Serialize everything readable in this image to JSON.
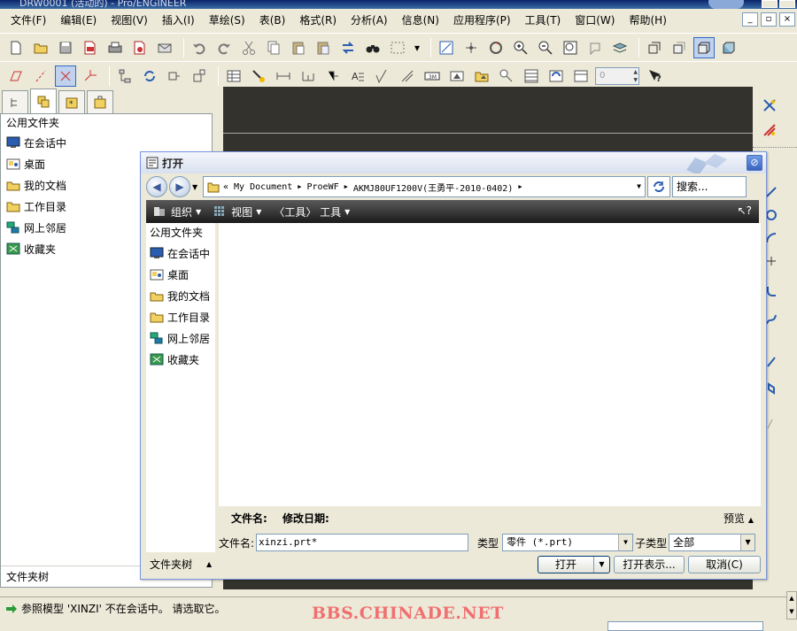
{
  "window": {
    "title": "DRW0001 (活动的) - Pro/ENGINEER"
  },
  "menu": [
    "文件(F)",
    "编辑(E)",
    "视图(V)",
    "插入(I)",
    "草绘(S)",
    "表(B)",
    "格式(R)",
    "分析(A)",
    "信息(N)",
    "应用程序(P)",
    "工具(T)",
    "窗口(W)",
    "帮助(H)"
  ],
  "toolbar": {
    "spinner_value": "0"
  },
  "navigator": {
    "header": "公用文件夹",
    "items": [
      "在会话中",
      "桌面",
      "我的文档",
      "工作目录",
      "网上邻居",
      "收藏夹"
    ],
    "footer": "文件夹树"
  },
  "status": {
    "message": "参照模型 'XINZI' 不在会话中。 请选取它。"
  },
  "watermark": "BBS.CHINADE.NET",
  "dialog": {
    "title": "打开",
    "address": {
      "prefix": "«",
      "crumbs": [
        "My Document",
        "ProeWF",
        "AKMJ80UF1200V(王勇平-2010-0402)"
      ]
    },
    "search_placeholder": "搜索...",
    "commands": {
      "organize": "组织",
      "views": "视图",
      "tools": "〈工具〉 工具"
    },
    "left": {
      "header": "公用文件夹",
      "items": [
        "在会话中",
        "桌面",
        "我的文档",
        "工作目录",
        "网上邻居",
        "收藏夹"
      ],
      "footer": "文件夹树"
    },
    "columns": {
      "name": "文件名:",
      "date": "修改日期:",
      "preview": "预览"
    },
    "filename_label": "文件名:",
    "filename_value": "xinzi.prt*",
    "type_label": "类型",
    "type_value": "零件 (*.prt)",
    "subtype_label": "子类型",
    "subtype_value": "全部",
    "buttons": {
      "open": "打开",
      "open_rep": "打开表示...",
      "cancel": "取消(C)"
    }
  }
}
